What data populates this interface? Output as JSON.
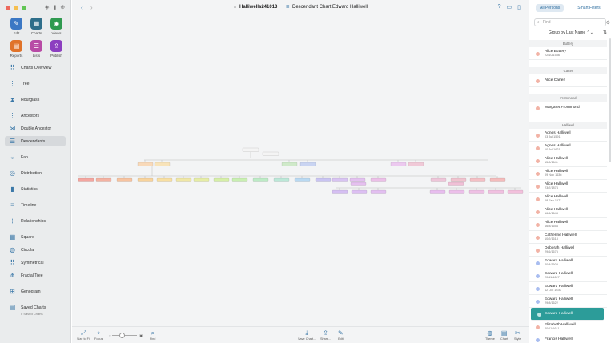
{
  "app": {
    "document_title": "Halliwells241013",
    "chart_title": "Descendant Chart Edward Halliwell"
  },
  "top_buttons": [
    {
      "label": "Edit",
      "color": "#3b78c4",
      "icon": "pencil-icon"
    },
    {
      "label": "Charts",
      "color": "#2e6e8a",
      "icon": "charts-icon"
    },
    {
      "label": "Views",
      "color": "#2f9a50",
      "icon": "eye-icon"
    },
    {
      "label": "Reports",
      "color": "#e0732a",
      "icon": "report-icon"
    },
    {
      "label": "Lists",
      "color": "#b84ba6",
      "icon": "list-icon"
    },
    {
      "label": "Publish",
      "color": "#8c3fc0",
      "icon": "publish-icon"
    }
  ],
  "nav": [
    {
      "label": "Charts Overview",
      "icon": "grid-icon"
    },
    {
      "label": "Tree",
      "icon": "tree-icon"
    },
    {
      "label": "Hourglass",
      "icon": "hourglass-icon"
    },
    {
      "label": "Ancestors",
      "icon": "ancestors-icon"
    },
    {
      "label": "Double Ancestor",
      "icon": "double-ancestor-icon"
    },
    {
      "label": "Descendants",
      "icon": "descendants-icon"
    },
    {
      "label": "Fan",
      "icon": "fan-icon"
    },
    {
      "label": "Distribution",
      "icon": "distribution-icon"
    },
    {
      "label": "Statistics",
      "icon": "statistics-icon"
    },
    {
      "label": "Timeline",
      "icon": "timeline-icon"
    },
    {
      "label": "Relationships",
      "icon": "relationships-icon"
    },
    {
      "label": "Square",
      "icon": "square-icon"
    },
    {
      "label": "Circular",
      "icon": "circular-icon"
    },
    {
      "label": "Symmetrical",
      "icon": "symmetrical-icon"
    },
    {
      "label": "Fractal Tree",
      "icon": "fractal-tree-icon"
    },
    {
      "label": "Genogram",
      "icon": "genogram-icon"
    },
    {
      "label": "Saved Charts",
      "icon": "saved-charts-icon",
      "sub": "0 Saved Charts"
    }
  ],
  "bottom": {
    "size_to_fit": "Size to Fit",
    "focus": "Focus",
    "find": "Find",
    "save_chart": "Save Chart...",
    "share": "Share...",
    "edit": "Edit",
    "theme": "Theme",
    "chart": "Chart",
    "style": "Style"
  },
  "right_panel": {
    "tab_all": "All Persons",
    "tab_smart": "Smart Filters",
    "find_placeholder": "Find",
    "group_by": "Group by Last Name",
    "sections": [
      {
        "name": "Buttery",
        "people": [
          {
            "name": "Alice Buttery",
            "date": "22/10/1586",
            "sex": "f"
          }
        ]
      },
      {
        "name": "Carter",
        "people": [
          {
            "name": "Alice Carter",
            "date": "",
            "sex": "f"
          }
        ]
      },
      {
        "name": "Frommond",
        "people": [
          {
            "name": "Margaret Frommond",
            "date": "",
            "sex": "f"
          }
        ]
      },
      {
        "name": "Halliwell",
        "people": [
          {
            "name": "Agnes Halliwell",
            "date": "03 Jul 1591",
            "sex": "f"
          },
          {
            "name": "Agnes Halliwell",
            "date": "10 Jul 1621",
            "sex": "f"
          },
          {
            "name": "Alice Halliwell",
            "date": "15/8/1641",
            "sex": "f"
          },
          {
            "name": "Alice Halliwell",
            "date": "09 Nov 1636",
            "sex": "f"
          },
          {
            "name": "Alice Halliwell",
            "date": "23/7/1874",
            "sex": "f"
          },
          {
            "name": "Alice Halliwell",
            "date": "08 Feb 1671",
            "sex": "f"
          },
          {
            "name": "Alice Halliwell",
            "date": "16/6/1643",
            "sex": "f"
          },
          {
            "name": "Alice Halliwell",
            "date": "16/8/1654",
            "sex": "f"
          },
          {
            "name": "Catherine Halliwell",
            "date": "10/2/1618",
            "sex": "f"
          },
          {
            "name": "Deborah Halliwell",
            "date": "29/6/1675",
            "sex": "f"
          },
          {
            "name": "Edward Halliwell",
            "date": "20/8/1603",
            "sex": "m"
          },
          {
            "name": "Edward Halliwell",
            "date": "20/11/1627",
            "sex": "m"
          },
          {
            "name": "Edward Halliwell",
            "date": "12 Oct 1630",
            "sex": "m"
          },
          {
            "name": "Edward Halliwell",
            "date": "29/8/1622",
            "sex": "m"
          },
          {
            "name": "Edward Halliwell",
            "date": "",
            "sex": "m",
            "selected": true
          },
          {
            "name": "Elizabeth Halliwell",
            "date": "20/11/1611",
            "sex": "f"
          },
          {
            "name": "Francis Halliwell",
            "date": "",
            "sex": "m"
          }
        ]
      }
    ]
  },
  "colors": {
    "female_dot": "#f2b3a6",
    "male_dot": "#a9bdf0",
    "selected": "#2c9c99",
    "accent": "#3b78a8"
  }
}
